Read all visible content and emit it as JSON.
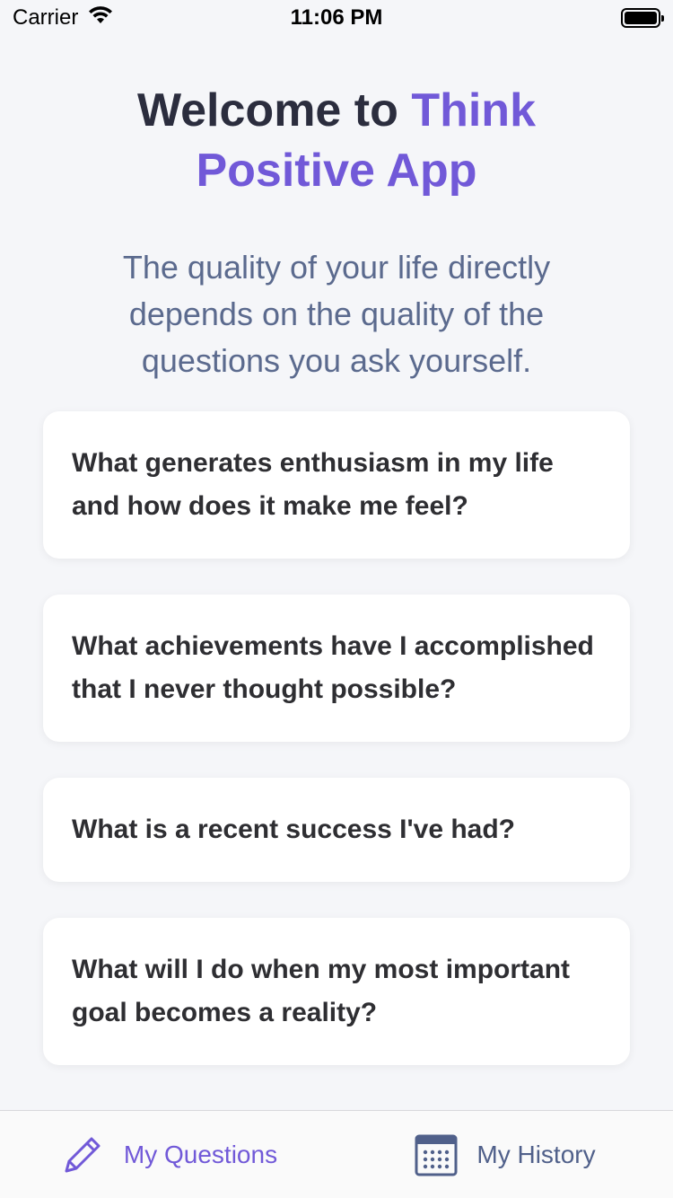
{
  "status_bar": {
    "carrier": "Carrier",
    "time": "11:06 PM"
  },
  "header": {
    "title_prefix": "Welcome to ",
    "title_accent": "Think Positive App",
    "subtitle": "The quality of your life directly depends on the quality of the questions you ask yourself."
  },
  "questions": [
    "What generates enthusiasm in my life and how does it make me feel?",
    "What achievements have I accomplished that I never thought possible?",
    "What is a recent success I've had?",
    "What will I do when my most important goal becomes a reality?"
  ],
  "tab_bar": {
    "tabs": [
      {
        "label": "My Questions",
        "icon": "pencil-icon",
        "active": true
      },
      {
        "label": "My History",
        "icon": "calendar-icon",
        "active": false
      }
    ]
  },
  "colors": {
    "accent": "#7159d8",
    "title": "#2b2d3e",
    "subtitle": "#5b6a8e",
    "inactive_tab": "#50608a",
    "background": "#f5f6f9"
  }
}
